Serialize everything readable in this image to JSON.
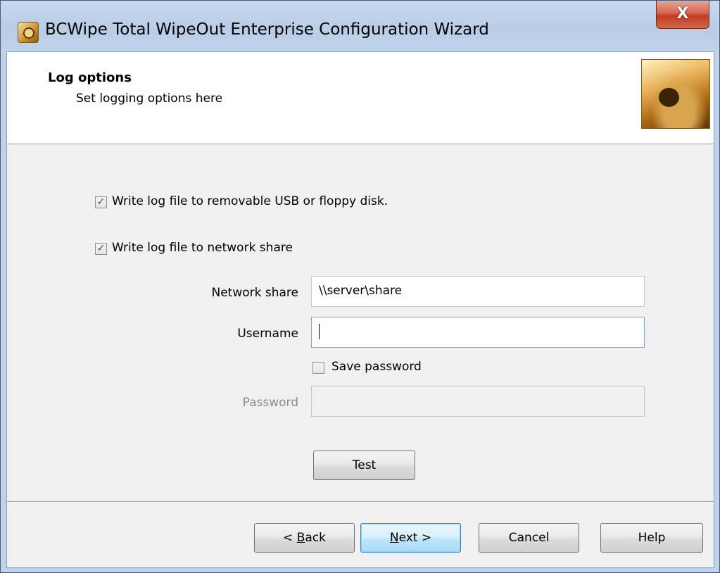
{
  "window": {
    "title": "BCWipe Total WipeOut Enterprise Configuration Wizard",
    "close_label": "X"
  },
  "header": {
    "title": "Log options",
    "subtitle": "Set logging options here"
  },
  "options": {
    "usb_label": "Write log file to removable USB or floppy disk.",
    "usb_checked": true,
    "network_label": "Write log file to network share",
    "network_checked": true
  },
  "form": {
    "network_share_label": "Network share",
    "network_share_value": "\\\\server\\share",
    "username_label": "Username",
    "username_value": "",
    "save_password_label": "Save password",
    "save_password_checked": false,
    "password_label": "Password",
    "password_value": "",
    "test_label": "Test"
  },
  "buttons": {
    "back_prefix": "< ",
    "back_mnemonic": "B",
    "back_rest": "ack",
    "next_mnemonic": "N",
    "next_rest": "ext >",
    "cancel": "Cancel",
    "help": "Help"
  },
  "icons": {
    "app": "wizard-app-icon",
    "header": "disk-drive-photo"
  }
}
